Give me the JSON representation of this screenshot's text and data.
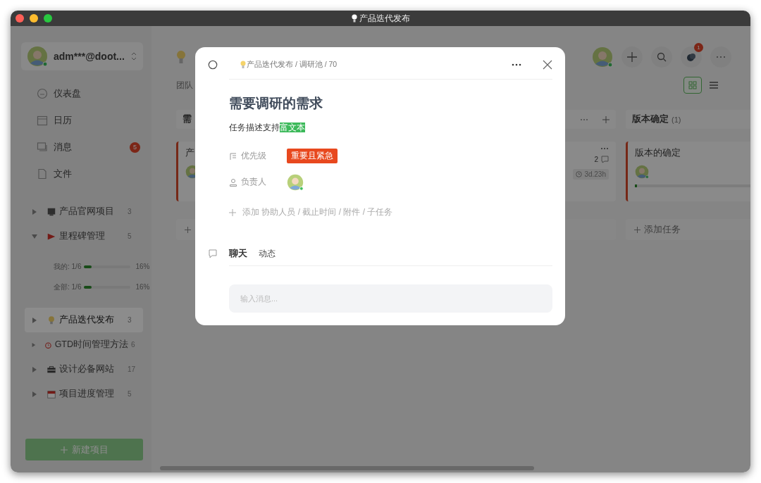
{
  "window": {
    "title": "产品迭代发布"
  },
  "sidebar": {
    "account": {
      "name": "adm***@doot..."
    },
    "nav": [
      {
        "label": "仪表盘"
      },
      {
        "label": "日历"
      },
      {
        "label": "消息",
        "badge": "5"
      },
      {
        "label": "文件"
      }
    ],
    "projects": [
      {
        "label": "产品官网项目",
        "count": "3",
        "expanded": false,
        "selected": false
      },
      {
        "label": "里程碑管理",
        "count": "5",
        "expanded": true,
        "selected": false,
        "stats": [
          {
            "label": "我的:",
            "value": "1/6",
            "level": 0.16,
            "percent": "16%"
          },
          {
            "label": "全部:",
            "value": "1/6",
            "level": 0.16,
            "percent": "16%"
          }
        ]
      },
      {
        "label": "产品迭代发布",
        "count": "3",
        "expanded": false,
        "selected": true
      },
      {
        "label": "GTD时间管理方法",
        "count": "6",
        "expanded": false,
        "selected": false
      },
      {
        "label": "设计必备网站",
        "count": "17",
        "expanded": false,
        "selected": false
      },
      {
        "label": "项目进度管理",
        "count": "5",
        "expanded": false,
        "selected": false
      }
    ],
    "new_project_button": "新建项目"
  },
  "main": {
    "notification_badge": "1",
    "subtitle": "团队",
    "views": [
      {
        "selected": true
      },
      {
        "selected": false
      }
    ],
    "columns": [
      {
        "title": "需",
        "cards": [
          {
            "title": "产",
            "flagged": true
          }
        ],
        "add_task": true
      },
      {
        "cards": [
          {
            "comments": "2",
            "due": "3d.23h"
          }
        ]
      },
      {
        "title": "版本确定",
        "count": "(1)",
        "cards": [
          {
            "title": "版本的确定",
            "flagged": true,
            "level": 0
          }
        ],
        "add_task": true,
        "add_task_label": "添加任务"
      }
    ]
  },
  "modal": {
    "breadcrumb": "产品迭代发布 / 调研池 / 70",
    "title": "需要调研的需求",
    "description": "任务描述支持**富文本**",
    "fields": [
      {
        "label": "优先级",
        "kind": "tag",
        "value": "重要且紧急"
      },
      {
        "label": "负责人",
        "kind": "avatar"
      }
    ],
    "add_more": "添加 协助人员 / 截止时间 / 附件 / 子任务",
    "tabs": [
      {
        "label": "聊天",
        "selected": true
      },
      {
        "label": "动态",
        "selected": false
      }
    ],
    "message_input": {
      "placeholder": "输入消息..."
    }
  }
}
